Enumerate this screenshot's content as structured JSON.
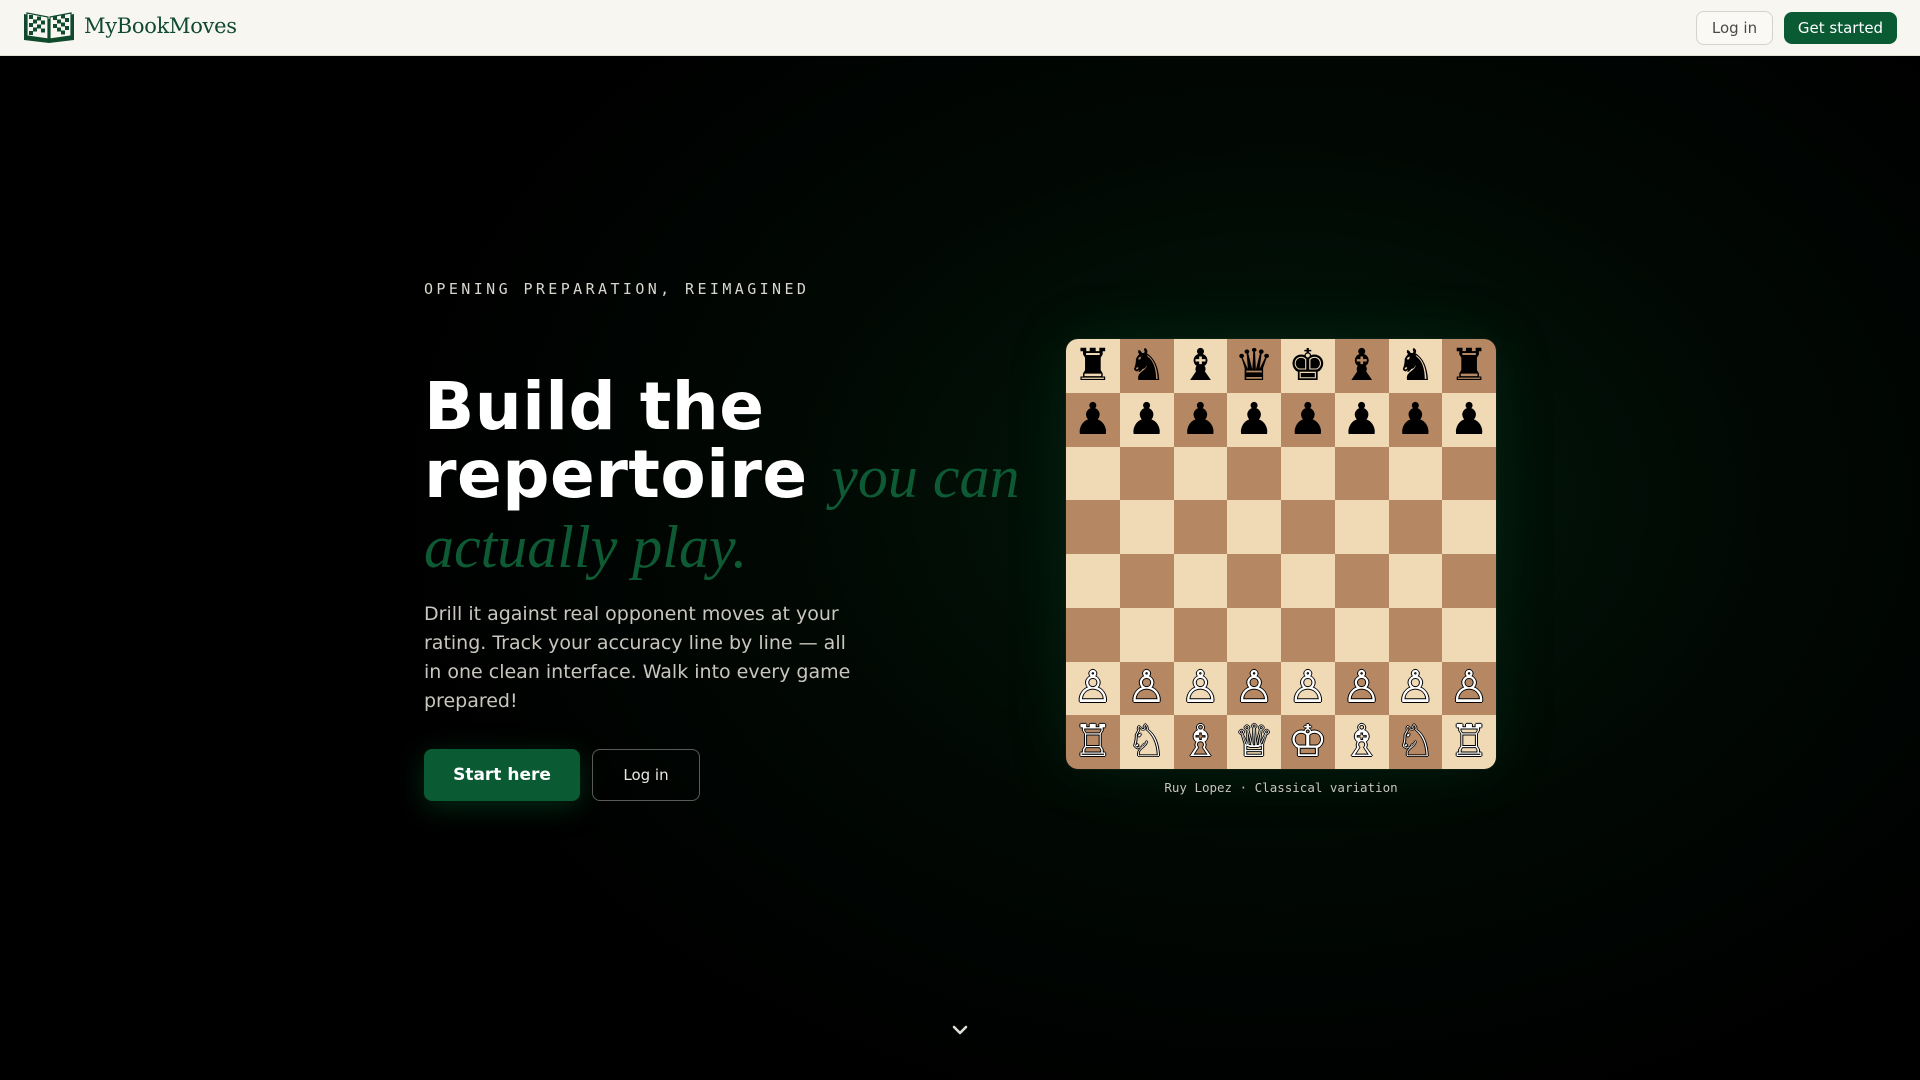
{
  "nav": {
    "brand_name": "MyBookMoves",
    "login_label": "Log in",
    "get_started_label": "Get started",
    "brand_icon": "open-book-chessboard-icon"
  },
  "hero": {
    "eyebrow": "OPENING PREPARATION, REIMAGINED",
    "headline_plain": "Build the repertoire",
    "headline_accent": "you can actually play.",
    "subcopy": "Drill it against real opponent moves at your rating. Track your accuracy line by line — all in one clean interface. Walk into every game prepared!",
    "primary_cta": "Start here",
    "secondary_cta": "Log in",
    "scroll_icon": "chevron-down-icon"
  },
  "board": {
    "caption": "Ruy Lopez · Classical variation",
    "ranks": [
      [
        "♜",
        "♞",
        "♝",
        "♛",
        "♚",
        "♝",
        "♞",
        "♜"
      ],
      [
        "♟",
        "♟",
        "♟",
        "♟",
        "♟",
        "♟",
        "♟",
        "♟"
      ],
      [
        "",
        "",
        "",
        "",
        "",
        "",
        "",
        ""
      ],
      [
        "",
        "",
        "",
        "",
        "",
        "",
        "",
        ""
      ],
      [
        "",
        "",
        "",
        "",
        "",
        "",
        "",
        ""
      ],
      [
        "",
        "",
        "",
        "",
        "",
        "",
        "",
        ""
      ],
      [
        "♙",
        "♙",
        "♙",
        "♙",
        "♙",
        "♙",
        "♙",
        "♙"
      ],
      [
        "♖",
        "♘",
        "♗",
        "♕",
        "♔",
        "♗",
        "♘",
        "♖"
      ]
    ],
    "light_square": "#f0d9b5",
    "dark_square": "#b58863"
  },
  "colors": {
    "accent": "#0a5a33",
    "accent_text": "#0d5a34",
    "nav_bg": "#f8f6f1",
    "background": "#000000"
  }
}
